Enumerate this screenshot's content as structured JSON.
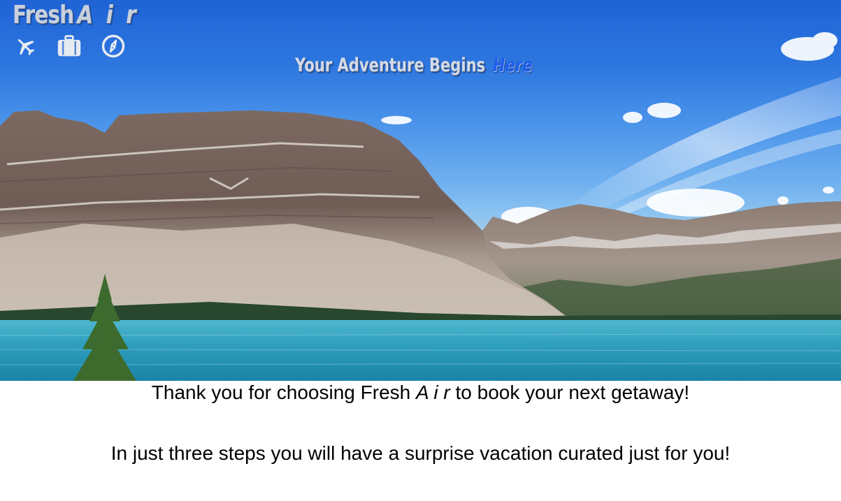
{
  "brand": {
    "name": "Fresh",
    "name_accent": "A i r"
  },
  "nav": {
    "icons": [
      "airplane-icon",
      "suitcase-icon",
      "compass-icon"
    ]
  },
  "hero": {
    "tagline": "Your Adventure Begins",
    "tagline_link": "Here"
  },
  "content": {
    "thanks_prefix": "Thank you for choosing Fresh ",
    "thanks_brand": "A i r",
    "thanks_suffix": " to book your next getaway!",
    "steps_text": "In just three steps you will have a surprise vacation curated just for you!"
  },
  "colors": {
    "sky": "#2e78e0",
    "lake": "#3aa6c2",
    "brand_text": "#c8d0de",
    "link": "#1f5fe8"
  }
}
